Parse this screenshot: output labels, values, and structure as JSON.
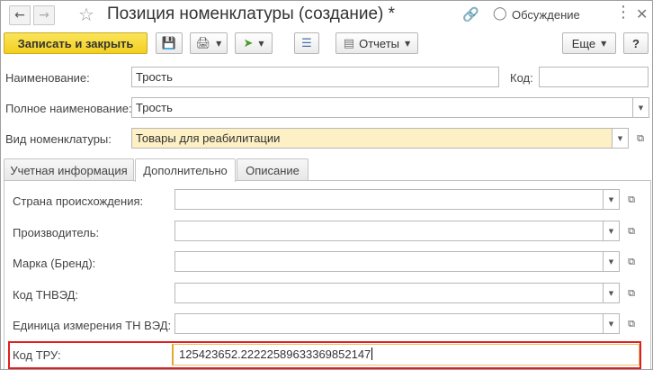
{
  "window": {
    "title": "Позиция номенклатуры (создание) *",
    "discussion_label": "Обсуждение"
  },
  "toolbar": {
    "save_close_label": "Записать и закрыть",
    "reports_label": "Отчеты",
    "more_label": "Еще",
    "help_label": "?"
  },
  "form": {
    "name_label": "Наименование:",
    "name_value": "Трость",
    "code_label": "Код:",
    "code_value": "",
    "full_name_label": "Полное наименование:",
    "full_name_value": "Трость",
    "kind_label": "Вид номенклатуры:",
    "kind_value": "Товары для реабилитации"
  },
  "tabs": [
    {
      "label": "Учетная информация",
      "active": false
    },
    {
      "label": "Дополнительно",
      "active": true
    },
    {
      "label": "Описание",
      "active": false
    }
  ],
  "additional": {
    "country_label": "Страна происхождения:",
    "country_value": "",
    "manufacturer_label": "Производитель:",
    "manufacturer_value": "",
    "brand_label": "Марка (Бренд):",
    "brand_value": "",
    "tnved_label": "Код ТНВЭД:",
    "tnved_value": "",
    "unit_label": "Единица измерения ТН ВЭД:",
    "unit_value": "",
    "tru_label": "Код ТРУ:",
    "tru_value": "125423652.222225896333698521​47"
  },
  "colors": {
    "primary_button": "#f2cf1f",
    "highlight_border": "#e02020",
    "required_field_bg": "#fdf0c4"
  }
}
